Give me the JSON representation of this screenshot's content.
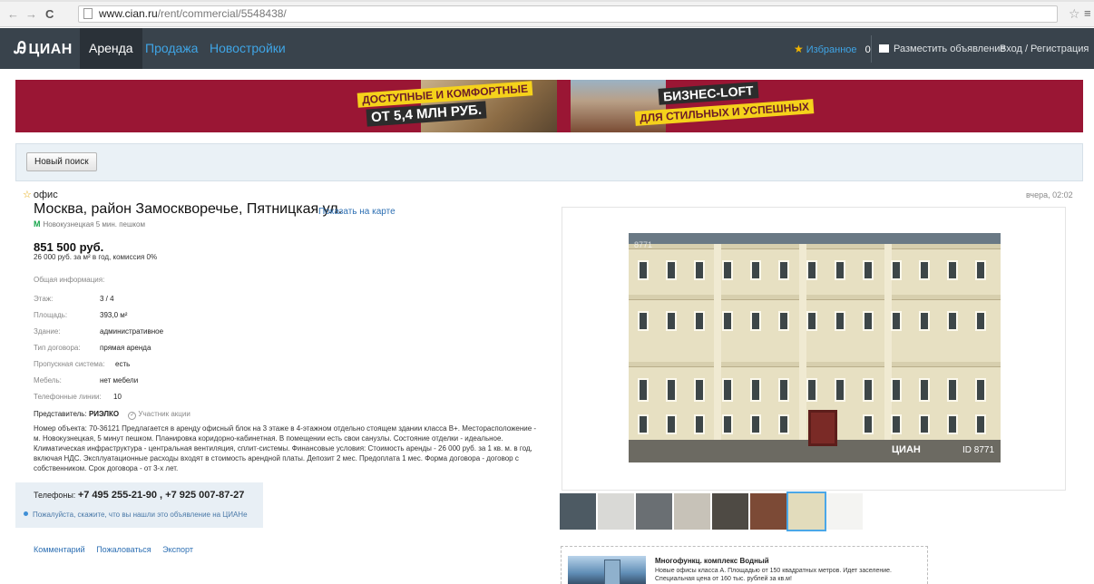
{
  "browser": {
    "url_host": "www.cian.ru",
    "url_path": "/rent/commercial/5548438/",
    "back": "←",
    "forward": "→",
    "reload": "C",
    "menu": "≡",
    "bookmark": "☆"
  },
  "header": {
    "logo": "ЦИАН",
    "logo_mark": "Ꭿ",
    "nav": [
      {
        "label": "Аренда",
        "active": true
      },
      {
        "label": "Продажа",
        "active": false
      },
      {
        "label": "Новостройки",
        "active": false
      }
    ],
    "favorites_label": "Избранное",
    "favorites_count": "0",
    "post_ad": "Разместить объявление",
    "login": "Вход / Регистрация"
  },
  "banner": {
    "text1": "ДОСТУПНЫЕ И КОМФОРТНЫЕ",
    "text2": "ОТ 5,4 МЛН РУБ.",
    "text3": "БИЗНЕС-LOFT",
    "text4": "ДЛЯ СТИЛЬНЫХ И УСПЕШНЫХ"
  },
  "search": {
    "new_search": "Новый поиск"
  },
  "listing": {
    "type": "офис",
    "date": "вчера, 02:02",
    "title": "Москва, район Замоскворечье, Пятницкая ул.",
    "map_link": "Показать на карте",
    "metro_icon": "М",
    "metro": "Новокузнецкая 5 мин. пешком",
    "price": "851 500 руб.",
    "price_sub": "26 000 руб. за м² в год, комиссия 0%",
    "info_head": "Общая информация:",
    "props": [
      {
        "key": "Этаж:",
        "value": "3 / 4"
      },
      {
        "key": "Площадь:",
        "value": "393,0 м²"
      },
      {
        "key": "Здание:",
        "value": "административное"
      },
      {
        "key": "Тип договора:",
        "value": "прямая аренда"
      },
      {
        "key": "Пропускная система:",
        "value": "есть"
      },
      {
        "key": "Мебель:",
        "value": "нет мебели"
      },
      {
        "key": "Телефонные линии:",
        "value": "10"
      }
    ],
    "agent_label": "Представитель:",
    "agent_name": "РИЭЛКО",
    "promo": "Участник акции",
    "description": "Номер объекта: 70-36121 Предлагается в аренду офисный блок на 3 этаже в 4-этажном отдельно стоящем здании класса В+. Месторасположение - м. Новокузнецкая, 5 минут пешком. Планировка коридорно-кабинетная. В помещении есть свои санузлы. Состояние отделки - идеальное. Климатическая инфраструктура - центральная вентиляция, сплит-системы. Финансовые условия: Стоимость аренды - 26 000 руб. за 1 кв. м. в год, включая НДС. Эксплуатационные расходы входят в стоимость арендной платы. Депозит 2 мес. Предоплата 1 мес. Форма договора - договор с собственником. Срок договора - от 3-х лет.",
    "phone_label": "Телефоны:",
    "phones": "+7 495 255-21-90 , +7 925 007-87-27",
    "phone_note": "Пожалуйста, скажите, что вы нашли это объявление на ЦИАНе",
    "actions": [
      "Комментарий",
      "Пожаловаться",
      "Экспорт"
    ]
  },
  "gallery": {
    "photo_id_top": "8771",
    "watermark": "ЦИАН",
    "watermark_id": "ID 8771",
    "thumb_colors": [
      "#4d5a63",
      "#d9d9d6",
      "#6a6f73",
      "#c7c2b8",
      "#4e4a44",
      "#7c4a36",
      "#e2dcbc",
      "#f4f4f2"
    ],
    "selected_thumb": 6
  },
  "ad": {
    "title": "Многофункц. комплекс Водный",
    "description": "Новые офисы класса А. Площадью от 150 квадратных метров. Идет заселение. Специальная цена от 160 тыс. рублей за кв.м!"
  },
  "colors": {
    "header_bg": "#39434c",
    "link": "#3fa5e6",
    "banner": "#9a1634",
    "accent_yellow": "#f5d21b"
  }
}
